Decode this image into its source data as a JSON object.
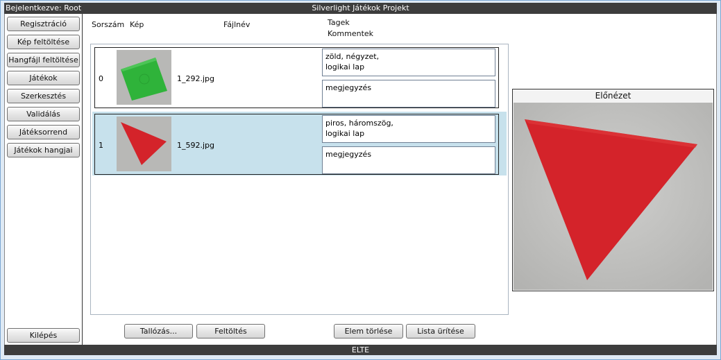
{
  "header": {
    "login_status": "Bejelentkezve: Root",
    "title": "Silverlight Játékok Projekt"
  },
  "footer": {
    "text": "ELTE"
  },
  "sidebar": {
    "items": [
      {
        "label": "Regisztráció"
      },
      {
        "label": "Kép feltöltése"
      },
      {
        "label": "Hangfájl feltöltése"
      },
      {
        "label": "Játékok"
      },
      {
        "label": "Szerkesztés"
      },
      {
        "label": "Validálás"
      },
      {
        "label": "Játéksorrend"
      },
      {
        "label": "Játékok hangjai"
      }
    ],
    "logout_label": "Kilépés"
  },
  "list": {
    "headers": {
      "index": "Sorszám",
      "image": "Kép",
      "filename": "Fájlnév",
      "tags": "Tagek",
      "comments": "Kommentek"
    },
    "rows": [
      {
        "index": "0",
        "filename": "1_292.jpg",
        "tags": "zöld, négyzet,\nlogikai lap",
        "comment": "megjegyzés",
        "thumbnail": "green-square",
        "selected": false
      },
      {
        "index": "1",
        "filename": "1_592.jpg",
        "tags": "piros, háromszög,\nlogikai lap",
        "comment": "megjegyzés",
        "thumbnail": "red-triangle",
        "selected": true
      }
    ]
  },
  "actions": {
    "browse_label": "Tallózás...",
    "upload_label": "Feltöltés",
    "delete_label": "Elem törlése",
    "clear_label": "Lista ürítése"
  },
  "preview": {
    "title": "Előnézet",
    "image": "red-triangle"
  },
  "colors": {
    "bar": "#3d3d3d",
    "selection": "#c7e1ec",
    "shape_green": "#2fb33a",
    "shape_red": "#d4232a"
  }
}
